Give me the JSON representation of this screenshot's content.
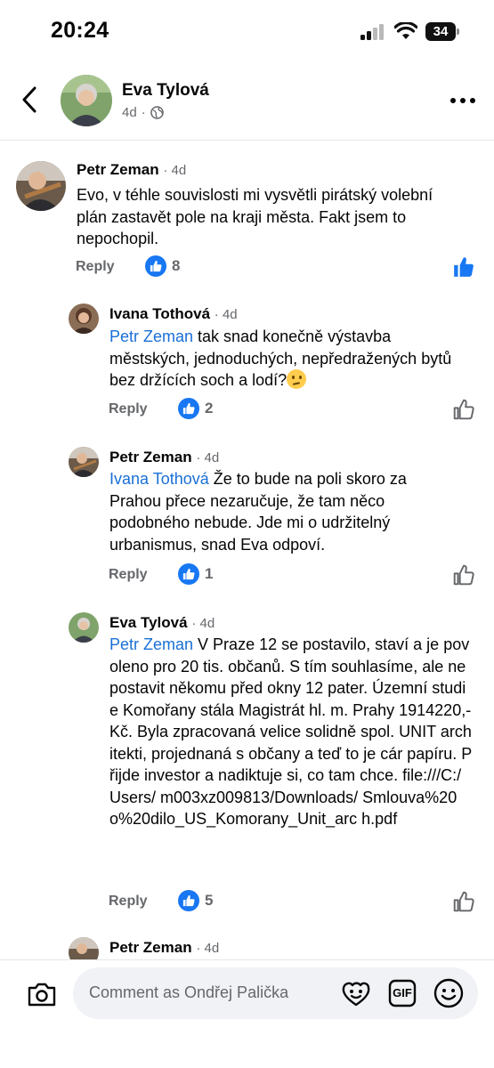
{
  "status_bar": {
    "time": "20:24",
    "battery": "34"
  },
  "post": {
    "author": "Eva Tylová",
    "age": "4d",
    "separator": "·"
  },
  "colors": {
    "accent": "#1877f2",
    "mention": "#1a6fd6",
    "meta": "#65676b"
  },
  "comments": [
    {
      "author": "Petr Zeman",
      "time": "· 4d",
      "text": "Evo, v téhle souvislosti mi vysvětli pirátský volební plán zastavět pole na kraji města. Fakt jsem to nepochopil.",
      "reply": "Reply",
      "reactions": "8",
      "liked": true
    },
    {
      "author": "Ivana Tothová",
      "time": "· 4d",
      "mention": "Petr Zeman",
      "text": " tak snad konečně výstavba městských, jednoduchých, nepředražených bytů bez držících soch a lodí?",
      "emoji": "thinking-face",
      "reply": "Reply",
      "reactions": "2",
      "liked": false
    },
    {
      "author": "Petr Zeman",
      "time": "· 4d",
      "mention": "Ivana Tothová",
      "text": " Že to bude na poli skoro za Prahou přece nezaručuje, že tam něco podobného nebude. Jde mi o udržitelný urbanismus, snad Eva odpoví.",
      "reply": "Reply",
      "reactions": "1",
      "liked": false
    },
    {
      "author": "Eva Tylová",
      "time": "· 4d",
      "mention": "Petr Zeman",
      "text": " V Praze 12 se postavilo, staví a je povoleno pro 20 tis. občanů. S tím souhlasíme, ale ne postavit někomu před okny 12 pater. Územní studie Komořany stála Magistrát hl. m. Prahy 1914220,- Kč. Byla zpracovaná velice solidně spol. UNIT architekti, projednaná s občany a teď to je cár papíru. Přijde investor a nadiktuje si, co tam chce. file:///C:/Users/ m003xz009813/Downloads/ Smlouva%20o%20dilo_US_Komorany_Unit_arc h.pdf",
      "reply": "Reply",
      "reactions": "5",
      "liked": false
    },
    {
      "author": "Petr Zeman",
      "time": "· 4d"
    }
  ],
  "composer": {
    "placeholder": "Comment as Ondřej Palička",
    "gif_label": "GIF"
  }
}
